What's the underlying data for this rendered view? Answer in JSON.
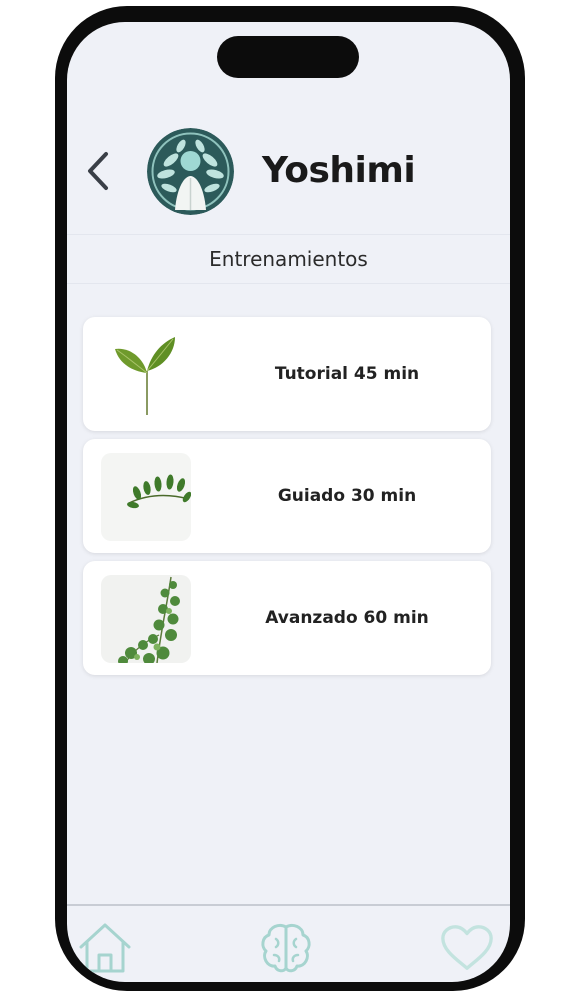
{
  "header": {
    "title": "Yoshimi",
    "back_icon": "chevron-left-icon",
    "logo_icon": "yoshimi-leaf-logo"
  },
  "section": {
    "title": "Entrenamientos"
  },
  "trainings": [
    {
      "label": "Tutorial 45 min",
      "thumbnail": "sprout-two-leaves"
    },
    {
      "label": "Guiado 30 min",
      "thumbnail": "leafy-branch"
    },
    {
      "label": "Avanzado 60 min",
      "thumbnail": "eucalyptus-plant"
    }
  ],
  "bottom_nav": {
    "items": [
      {
        "name": "home",
        "icon": "home-icon"
      },
      {
        "name": "brain",
        "icon": "brain-icon"
      },
      {
        "name": "favorites",
        "icon": "heart-icon"
      }
    ],
    "icon_color": "#a6d4cf"
  },
  "colors": {
    "background": "#eff1f7",
    "card": "#ffffff",
    "frame": "#0c0c0c",
    "accent": "#a6d4cf",
    "logo_dark": "#2c5a5a"
  }
}
